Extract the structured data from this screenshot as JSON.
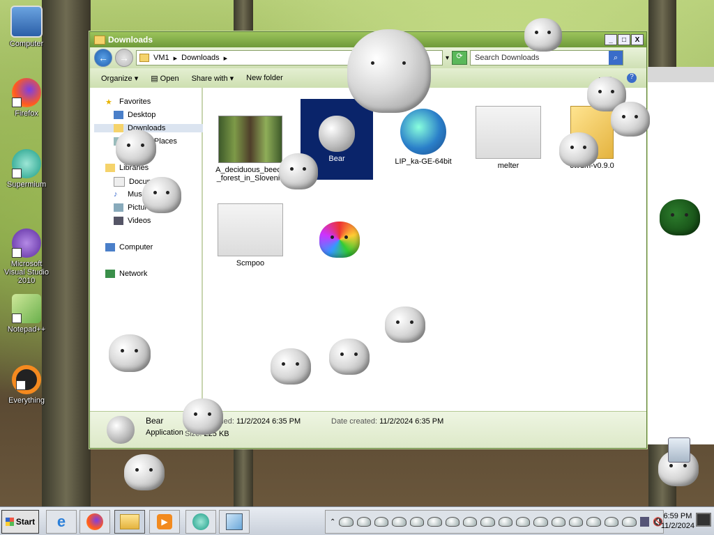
{
  "desktop": {
    "icons": [
      {
        "label": "Computer",
        "icon": "computer-icon"
      },
      {
        "label": "Firefox",
        "icon": "firefox-icon"
      },
      {
        "label": "Supermium",
        "icon": "supermium-icon"
      },
      {
        "label": "Microsoft Visual Studio 2010",
        "icon": "visual-studio-icon"
      },
      {
        "label": "Notepad++",
        "icon": "notepadpp-icon"
      },
      {
        "label": "Everything",
        "icon": "everything-icon"
      }
    ]
  },
  "window": {
    "title": "Downloads",
    "controls": {
      "minimize": "_",
      "maximize": "□",
      "close": "X"
    },
    "breadcrumb": [
      "VM1",
      "Downloads"
    ],
    "search_placeholder": "Search Downloads",
    "commands": {
      "organize": "Organize",
      "open": "Open",
      "share_with": "Share with",
      "new_folder": "New folder"
    },
    "nav": {
      "favorites": "Favorites",
      "desktop": "Desktop",
      "downloads": "Downloads",
      "recent_places": "Recent Places",
      "libraries": "Libraries",
      "documents": "Documents",
      "music": "Music",
      "pictures": "Pictures",
      "videos": "Videos",
      "computer": "Computer",
      "network": "Network"
    },
    "files": [
      {
        "name": "A_deciduous_beech_forest_in_Slovenia",
        "icon": "forest-image-thumbnail"
      },
      {
        "name": "Bear",
        "icon": "bear-icon",
        "selected": true
      },
      {
        "name": "LIP_ka-GE-64bit",
        "icon": "globe-installer-icon"
      },
      {
        "name": "melter",
        "icon": "window-app-icon"
      },
      {
        "name": "otvdm-v0.9.0",
        "icon": "folder-icon"
      },
      {
        "name": "Scmpoo",
        "icon": "window-app-icon"
      }
    ],
    "details": {
      "name": "Bear",
      "type": "Application",
      "date_modified_label": "Date modified:",
      "date_modified": "11/2/2024 6:35 PM",
      "date_created_label": "Date created:",
      "date_created": "11/2/2024 6:35 PM",
      "size_label": "Size:",
      "size": "225 KB"
    }
  },
  "taskbar": {
    "start_label": "Start",
    "clock_time": "6:59 PM",
    "clock_date": "11/2/2024",
    "apps": [
      "ie-icon",
      "firefox-icon",
      "explorer-icon",
      "media-player-icon",
      "supermium-icon",
      "notepad-icon"
    ]
  },
  "colors": {
    "titlebar": "#7aa645",
    "selection": "#0a246a",
    "taskbar": "#d5dbe3"
  }
}
